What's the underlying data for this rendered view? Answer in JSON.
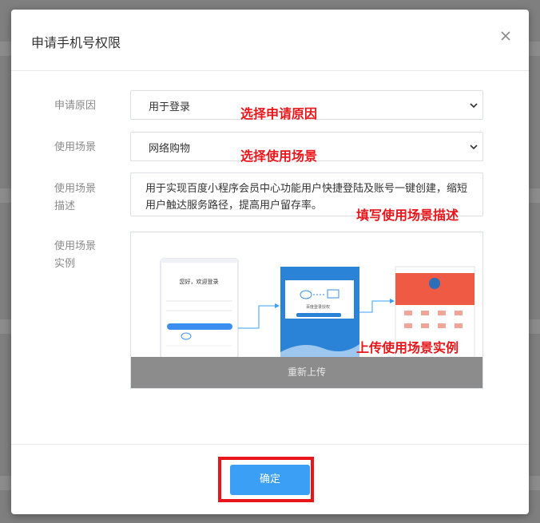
{
  "dialog": {
    "title": "申请手机号权限",
    "close_icon": "close-icon"
  },
  "form": {
    "reason": {
      "label": "申请原因",
      "value": "用于登录"
    },
    "scene": {
      "label": "使用场景",
      "value": "网络购物"
    },
    "description": {
      "label_line1": "使用场景",
      "label_line2": "描述",
      "value": "用于实现百度小程序会员中心功能用户快捷登陆及账号一键创建，缩短用户触达服务路径，提高用户留存率。"
    },
    "example": {
      "label_line1": "使用场景",
      "label_line2": "实例",
      "reupload_label": "重新上传",
      "screen1": {
        "greeting": "您好，欢迎登录",
        "login_button_icon": "login-button"
      },
      "screen2": {
        "caption": "百度登录授权"
      }
    }
  },
  "annotations": {
    "reason": "选择申请原因",
    "scene": "选择使用场景",
    "description": "填写使用场景描述",
    "example": "上传使用场景实例"
  },
  "footer": {
    "confirm_label": "确定"
  },
  "colors": {
    "accent": "#3a9ff5",
    "annotation": "#e8161b",
    "overlay": "#7f7f7f"
  }
}
